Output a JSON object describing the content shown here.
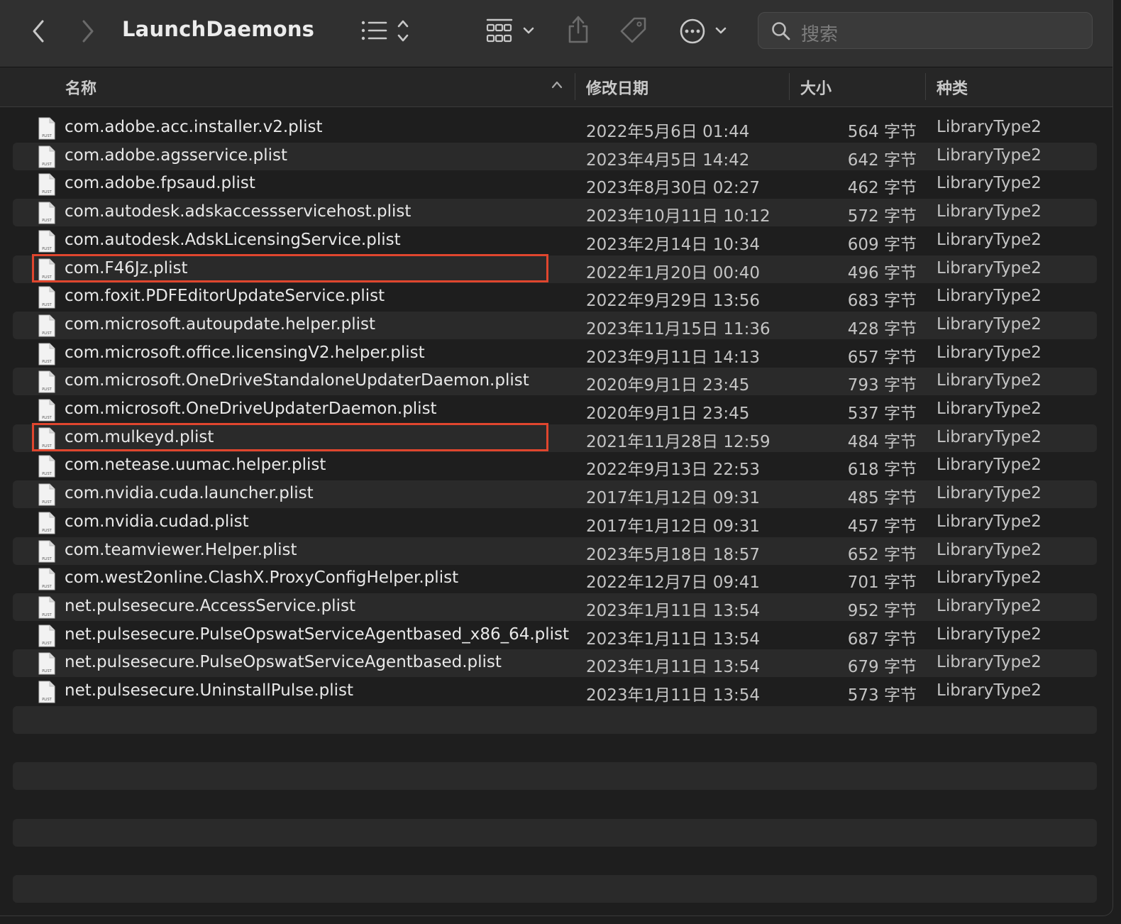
{
  "toolbar": {
    "title": "LaunchDaemons",
    "search_placeholder": "搜索"
  },
  "columns": {
    "name": "名称",
    "date": "修改日期",
    "size": "大小",
    "kind": "种类"
  },
  "files": [
    {
      "name": "com.adobe.acc.installer.v2.plist",
      "date": "2022年5月6日 01:44",
      "size": "564 字节",
      "kind": "LibraryType2",
      "highlighted": false
    },
    {
      "name": "com.adobe.agsservice.plist",
      "date": "2023年4月5日 14:42",
      "size": "642 字节",
      "kind": "LibraryType2",
      "highlighted": false
    },
    {
      "name": "com.adobe.fpsaud.plist",
      "date": "2023年8月30日 02:27",
      "size": "462 字节",
      "kind": "LibraryType2",
      "highlighted": false
    },
    {
      "name": "com.autodesk.adskaccessservicehost.plist",
      "date": "2023年10月11日 10:12",
      "size": "572 字节",
      "kind": "LibraryType2",
      "highlighted": false
    },
    {
      "name": "com.autodesk.AdskLicensingService.plist",
      "date": "2023年2月14日 10:34",
      "size": "609 字节",
      "kind": "LibraryType2",
      "highlighted": false
    },
    {
      "name": "com.F46Jz.plist",
      "date": "2022年1月20日 00:40",
      "size": "496 字节",
      "kind": "LibraryType2",
      "highlighted": true
    },
    {
      "name": "com.foxit.PDFEditorUpdateService.plist",
      "date": "2022年9月29日 13:56",
      "size": "683 字节",
      "kind": "LibraryType2",
      "highlighted": false
    },
    {
      "name": "com.microsoft.autoupdate.helper.plist",
      "date": "2023年11月15日 11:36",
      "size": "428 字节",
      "kind": "LibraryType2",
      "highlighted": false
    },
    {
      "name": "com.microsoft.office.licensingV2.helper.plist",
      "date": "2023年9月11日 14:13",
      "size": "657 字节",
      "kind": "LibraryType2",
      "highlighted": false
    },
    {
      "name": "com.microsoft.OneDriveStandaloneUpdaterDaemon.plist",
      "date": "2020年9月1日 23:45",
      "size": "793 字节",
      "kind": "LibraryType2",
      "highlighted": false
    },
    {
      "name": "com.microsoft.OneDriveUpdaterDaemon.plist",
      "date": "2020年9月1日 23:45",
      "size": "537 字节",
      "kind": "LibraryType2",
      "highlighted": false
    },
    {
      "name": "com.mulkeyd.plist",
      "date": "2021年11月28日 12:59",
      "size": "484 字节",
      "kind": "LibraryType2",
      "highlighted": true
    },
    {
      "name": "com.netease.uumac.helper.plist",
      "date": "2022年9月13日 22:53",
      "size": "618 字节",
      "kind": "LibraryType2",
      "highlighted": false
    },
    {
      "name": "com.nvidia.cuda.launcher.plist",
      "date": "2017年1月12日 09:31",
      "size": "485 字节",
      "kind": "LibraryType2",
      "highlighted": false
    },
    {
      "name": "com.nvidia.cudad.plist",
      "date": "2017年1月12日 09:31",
      "size": "457 字节",
      "kind": "LibraryType2",
      "highlighted": false
    },
    {
      "name": "com.teamviewer.Helper.plist",
      "date": "2023年5月18日 18:57",
      "size": "652 字节",
      "kind": "LibraryType2",
      "highlighted": false
    },
    {
      "name": "com.west2online.ClashX.ProxyConfigHelper.plist",
      "date": "2022年12月7日 09:41",
      "size": "701 字节",
      "kind": "LibraryType2",
      "highlighted": false
    },
    {
      "name": "net.pulsesecure.AccessService.plist",
      "date": "2023年1月11日 13:54",
      "size": "952 字节",
      "kind": "LibraryType2",
      "highlighted": false
    },
    {
      "name": "net.pulsesecure.PulseOpswatServiceAgentbased_x86_64.plist",
      "date": "2023年1月11日 13:54",
      "size": "687 字节",
      "kind": "LibraryType2",
      "highlighted": false
    },
    {
      "name": "net.pulsesecure.PulseOpswatServiceAgentbased.plist",
      "date": "2023年1月11日 13:54",
      "size": "679 字节",
      "kind": "LibraryType2",
      "highlighted": false
    },
    {
      "name": "net.pulsesecure.UninstallPulse.plist",
      "date": "2023年1月11日 13:54",
      "size": "573 字节",
      "kind": "LibraryType2",
      "highlighted": false
    }
  ],
  "colors": {
    "highlight_border": "#e0462e",
    "row_alt": "#2a2a2a",
    "background": "#1e1e1e"
  }
}
